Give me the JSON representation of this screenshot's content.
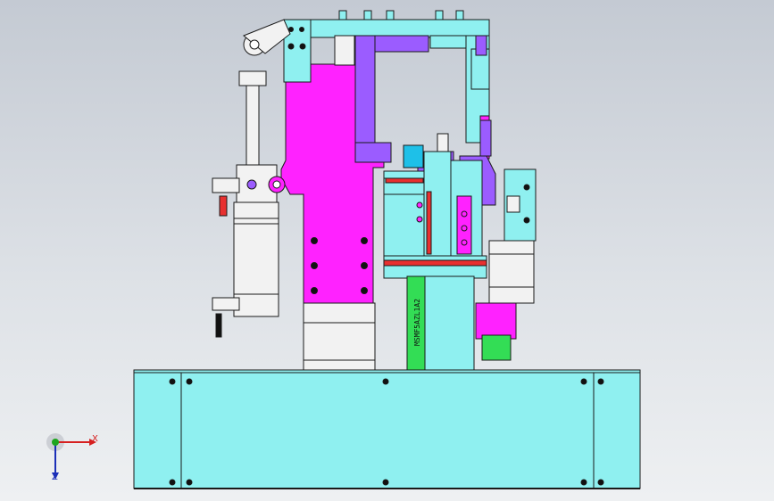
{
  "viewport": {
    "background_top": "#c4cad3",
    "background_bottom": "#eef0f2"
  },
  "model": {
    "part_colors": {
      "frame": "#8ff0f0",
      "plate": "#ff22ff",
      "bracket": "#9b5cff",
      "cylinder": "#f2f2f2",
      "motor": "#a6ff66",
      "block": "#33dd55",
      "fitting_red": "#e83030",
      "edge": "#1a1a1a"
    },
    "motor_label": "MSMF5AZL1A2"
  },
  "triad": {
    "x_label": "X",
    "z_label": "Z",
    "x_color": "#d62020",
    "y_color": "#1ea51e",
    "z_color": "#1b2fb8"
  }
}
